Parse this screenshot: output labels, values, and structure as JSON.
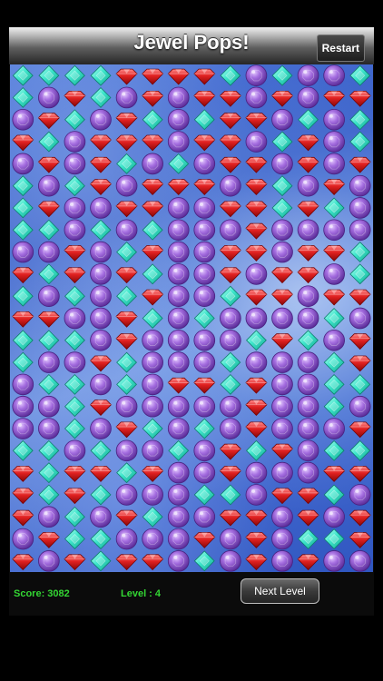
{
  "header": {
    "title": "Jewel Pops!",
    "restart_label": "Restart"
  },
  "footer": {
    "score_text": "Score: 3082",
    "level_text": "Level : 4",
    "next_level_label": "Next Level"
  },
  "colors": {
    "ruby": "#e02020",
    "amethyst": "#9a5bd2",
    "aqua": "#33e0c8",
    "status_green": "#33d633"
  },
  "board": {
    "legend": "R = ruby (red), P = amethyst (purple), A = aqua (teal)",
    "rows": [
      "AAAARRRRAPAPPA",
      "APRAPRPRRPRPRR",
      "PRAPRAPARRPAPA",
      "RAPRRRPRRPARPA",
      "PRPRAPAPRRPRPR",
      "APARPRRRPRAPRP",
      "ARPPRRPPRRARAP",
      "AAPAPAPPPRPPPP",
      "PPRPARPPRRPRRA",
      "RARPRAPPRPRRPA",
      "APAPARPPARRPRR",
      "RRPPRAPAPPPPAP",
      "AAAPRPPPPARAPR",
      "APPRAPPPAPPPAR",
      "PAAPAPRRARPPAA",
      "PPARPPPPPRPPAP",
      "PPAPRAPAPRPPPR",
      "AAPAPPAPRARPAA",
      "RARRARPPRPPPRR",
      "RARAPPPAAPRRAP",
      "RPAPRAPPRRPRPR",
      "PRAAPPPRPRPAAR",
      "RPRARRPAPRPRPP"
    ]
  }
}
